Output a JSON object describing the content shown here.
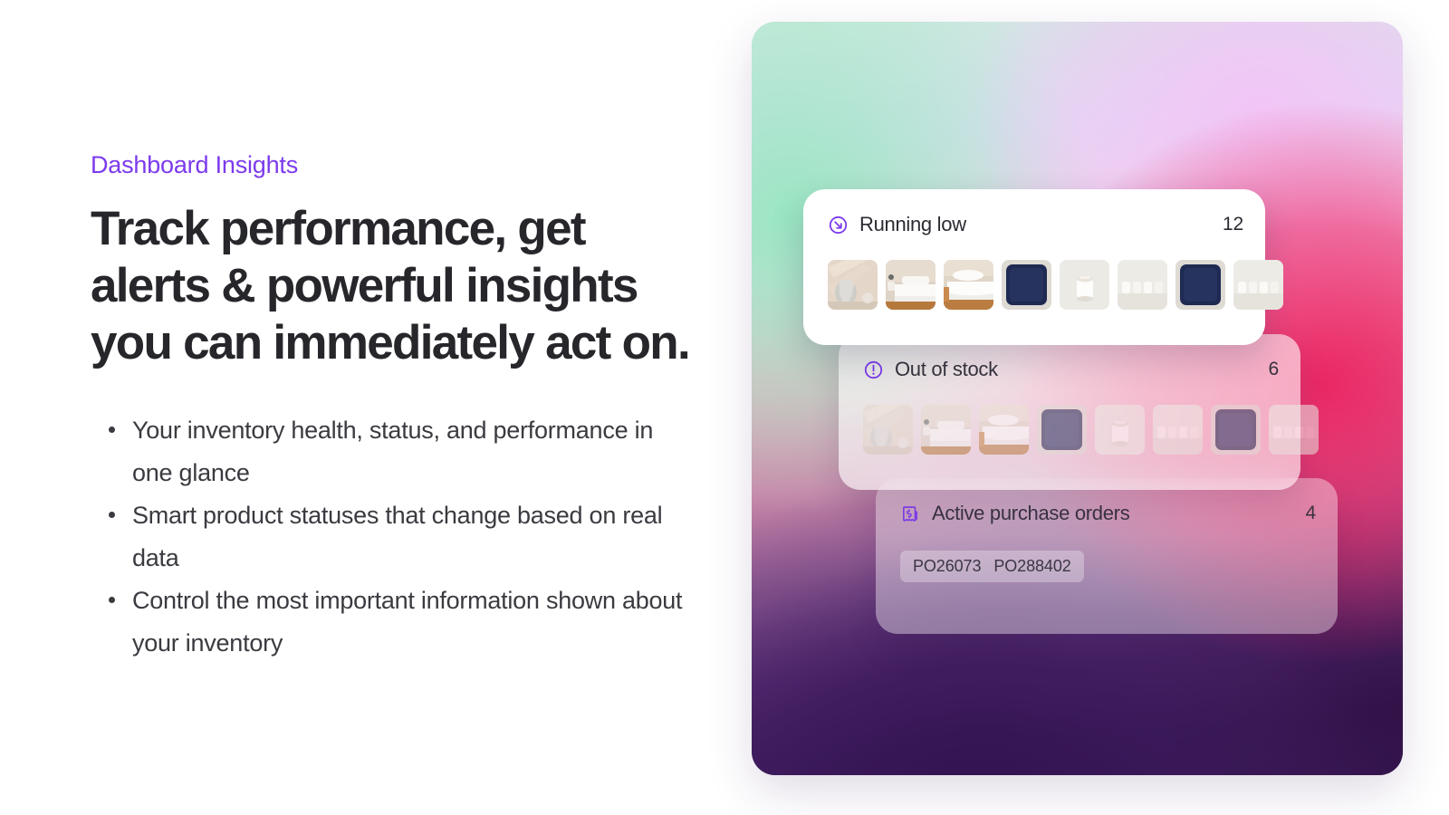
{
  "left": {
    "eyebrow": "Dashboard Insights",
    "headline": "Track performance, get alerts & powerful insights you can immediately act on.",
    "bullets": [
      "Your inventory health, status, and performance in one glance",
      "Smart product statuses that change based on real data",
      "Control the most important information shown about your inventory"
    ]
  },
  "colors": {
    "eyebrow_purple": "#7c3aed",
    "headline_dark": "#26262b",
    "body_text": "#3a3a40",
    "icon_purple": "#7c3aed",
    "gradient_mint": "#96e7c0",
    "gradient_lavender": "#f3c4f6",
    "gradient_crimson": "#ec1e5f",
    "gradient_deep_purple": "#3a1a55",
    "navy_pillow": "#1e2a52",
    "card_white": "#ffffff"
  },
  "cards": [
    {
      "id": "running-low",
      "icon": "arrow-down-right-circle-icon",
      "title": "Running low",
      "count": "12",
      "thumbnails": [
        {
          "alt": "beige-throw-blanket-thumbnail",
          "kind": "throw"
        },
        {
          "alt": "white-bed-linen-thumbnail",
          "kind": "bed"
        },
        {
          "alt": "white-bedding-set-thumbnail",
          "kind": "bedding"
        },
        {
          "alt": "navy-velvet-cushion-thumbnail",
          "kind": "pillow"
        },
        {
          "alt": "white-ceramic-candle-thumbnail",
          "kind": "candle"
        },
        {
          "alt": "white-candle-holders-thumbnail",
          "kind": "holders"
        },
        {
          "alt": "navy-velvet-cushion-thumbnail",
          "kind": "pillow"
        },
        {
          "alt": "white-candle-holders-thumbnail",
          "kind": "holders"
        }
      ]
    },
    {
      "id": "out-of-stock",
      "icon": "exclamation-circle-icon",
      "title": "Out of stock",
      "count": "6",
      "thumbnails": [
        {
          "alt": "beige-throw-blanket-thumbnail",
          "kind": "throw"
        },
        {
          "alt": "white-bed-linen-thumbnail",
          "kind": "bed"
        },
        {
          "alt": "white-bedding-set-thumbnail",
          "kind": "bedding"
        },
        {
          "alt": "navy-velvet-cushion-thumbnail",
          "kind": "pillow"
        },
        {
          "alt": "white-ceramic-candle-thumbnail",
          "kind": "candle"
        },
        {
          "alt": "white-candle-holders-thumbnail",
          "kind": "holders"
        },
        {
          "alt": "navy-velvet-cushion-thumbnail",
          "kind": "pillow"
        },
        {
          "alt": "white-candle-holders-thumbnail",
          "kind": "holders"
        }
      ]
    },
    {
      "id": "purchase-orders",
      "icon": "receipt-dollar-icon",
      "title": "Active purchase orders",
      "count": "4",
      "order_numbers": [
        "PO26073",
        "PO288402"
      ]
    }
  ]
}
